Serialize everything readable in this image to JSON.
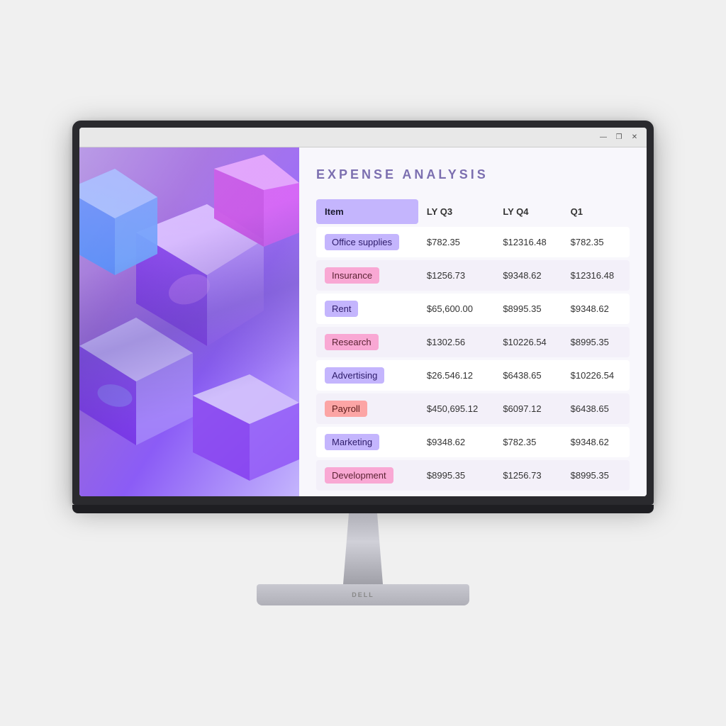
{
  "window": {
    "title": "Expense Analysis",
    "controls": [
      "minimize",
      "maximize",
      "close"
    ]
  },
  "title_bar": {
    "minimize_label": "—",
    "maximize_label": "❐",
    "close_label": "✕"
  },
  "spreadsheet": {
    "title": "EXPENSE ANALYSIS",
    "columns": [
      "Item",
      "LY Q3",
      "LY Q4",
      "Q1"
    ],
    "rows": [
      {
        "item": "Office supplies",
        "lyq3": "$782.35",
        "lyq4": "$12316.48",
        "q1": "$782.35",
        "style": "lavender"
      },
      {
        "item": "Insurance",
        "lyq3": "$1256.73",
        "lyq4": "$9348.62",
        "q1": "$12316.48",
        "style": "pink"
      },
      {
        "item": "Rent",
        "lyq3": "$65,600.00",
        "lyq4": "$8995.35",
        "q1": "$9348.62",
        "style": "lavender"
      },
      {
        "item": "Research",
        "lyq3": "$1302.56",
        "lyq4": "$10226.54",
        "q1": "$8995.35",
        "style": "pink"
      },
      {
        "item": "Advertising",
        "lyq3": "$26.546.12",
        "lyq4": "$6438.65",
        "q1": "$10226.54",
        "style": "lavender"
      },
      {
        "item": "Payroll",
        "lyq3": "$450,695.12",
        "lyq4": "$6097.12",
        "q1": "$6438.65",
        "style": "light-pink"
      },
      {
        "item": "Marketing",
        "lyq3": "$9348.62",
        "lyq4": "$782.35",
        "q1": "$9348.62",
        "style": "lavender"
      },
      {
        "item": "Development",
        "lyq3": "$8995.35",
        "lyq4": "$1256.73",
        "q1": "$8995.35",
        "style": "pink"
      }
    ]
  },
  "stand": {
    "brand": "DELL"
  }
}
